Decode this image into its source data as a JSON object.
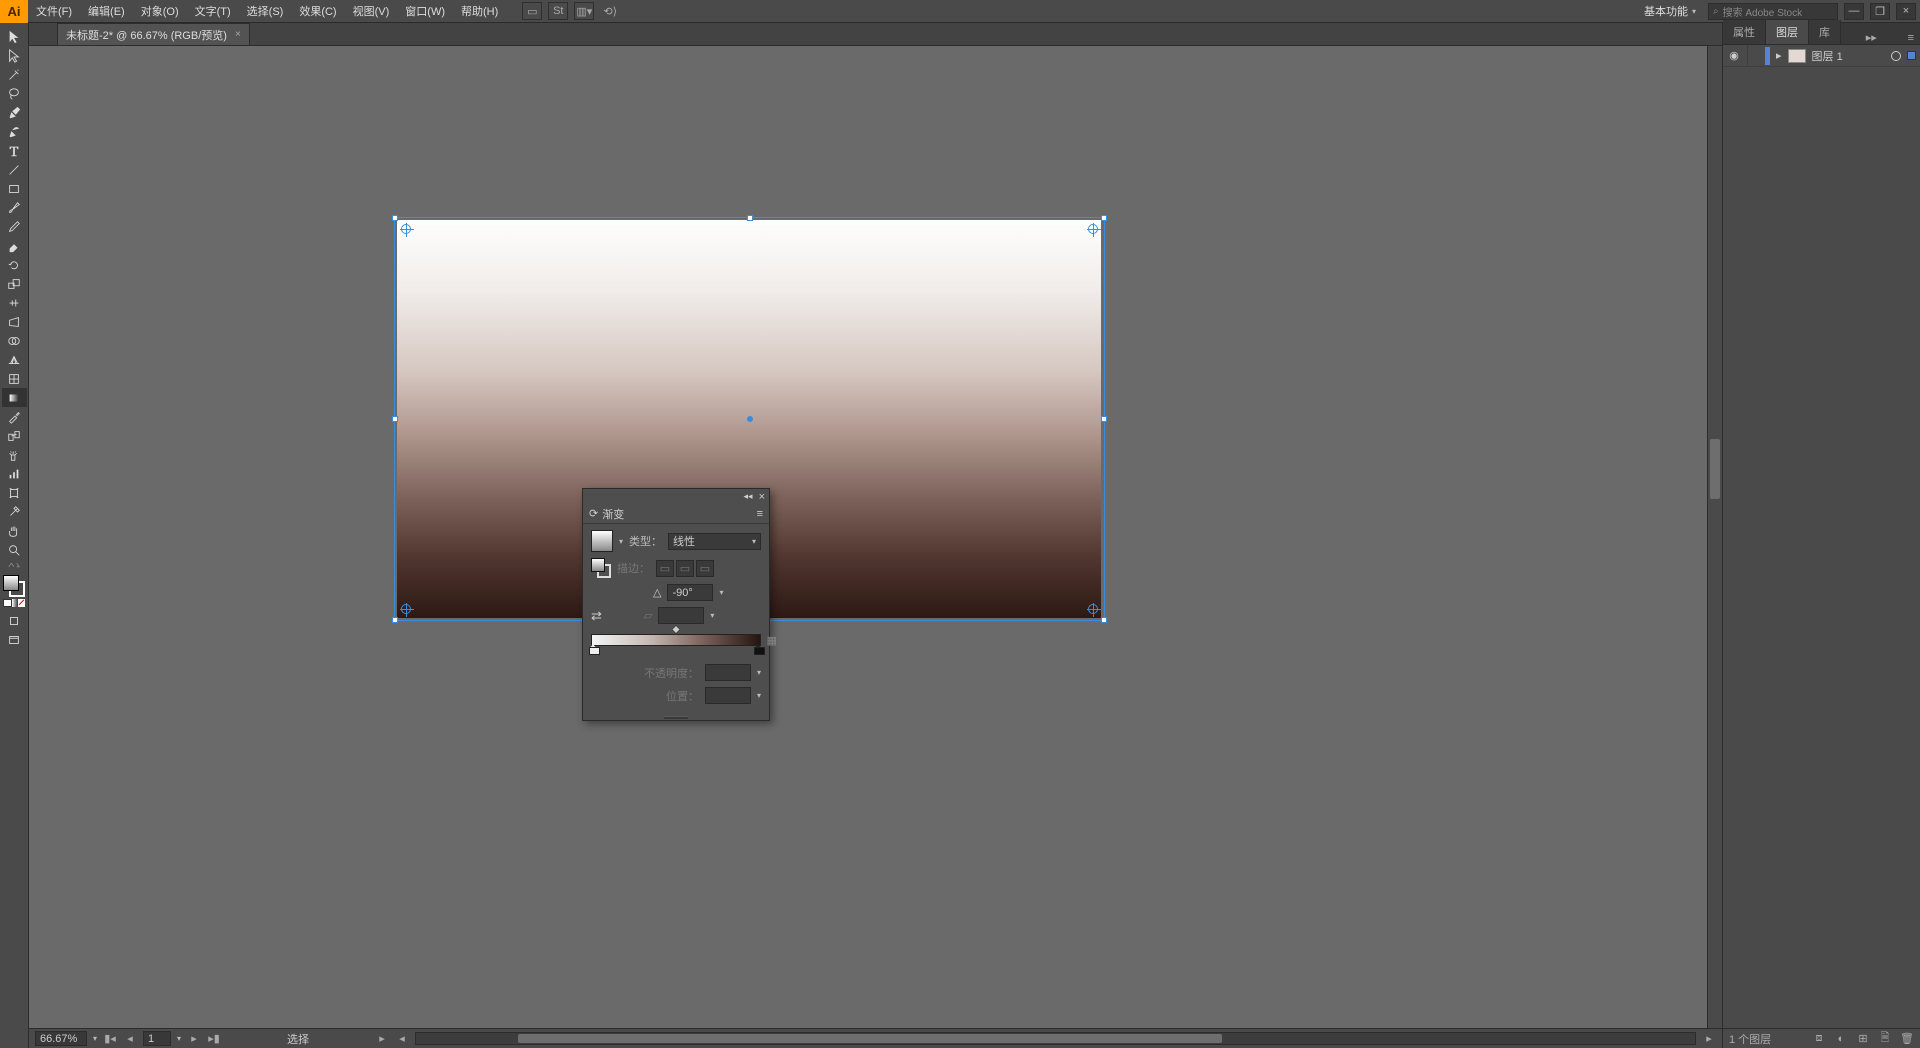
{
  "app_logo": "Ai",
  "menu": {
    "file": "文件(F)",
    "edit": "编辑(E)",
    "object": "对象(O)",
    "text": "文字(T)",
    "select": "选择(S)",
    "effect": "效果(C)",
    "view": "视图(V)",
    "window": "窗口(W)",
    "help": "帮助(H)"
  },
  "workspace": "基本功能",
  "search_placeholder": "搜索 Adobe Stock",
  "document_tab": "未标题-2* @ 66.67% (RGB/预览)",
  "zoom": "66.67%",
  "artboard_index": "1",
  "status_mode": "选择",
  "rpanel_tabs": {
    "properties": "属性",
    "layers": "图层",
    "libraries": "库"
  },
  "layer_name": "图层 1",
  "layer_count": "1 个图层",
  "gradient_panel": {
    "title": "渐变",
    "type_label": "类型：",
    "type_value": "线性",
    "stroke_label": "描边：",
    "angle_value": "-90°",
    "opacity_label": "不透明度：",
    "location_label": "位置："
  },
  "glyphs": {
    "chev_down": "▾",
    "close": "×",
    "tri_left": "◂",
    "tri_right": "▸",
    "bar_left": "▮◂",
    "bar_right": "▸▮",
    "menu": "≡",
    "search": "⌕",
    "minimize": "—",
    "maximize": "❐",
    "reload": "↻",
    "refresh": "⟳",
    "expand": "▸",
    "eye": "◉",
    "lock": "🔒",
    "trash": "🗑",
    "plus": "⊞",
    "collapse": "⇲",
    "angle": "△"
  }
}
